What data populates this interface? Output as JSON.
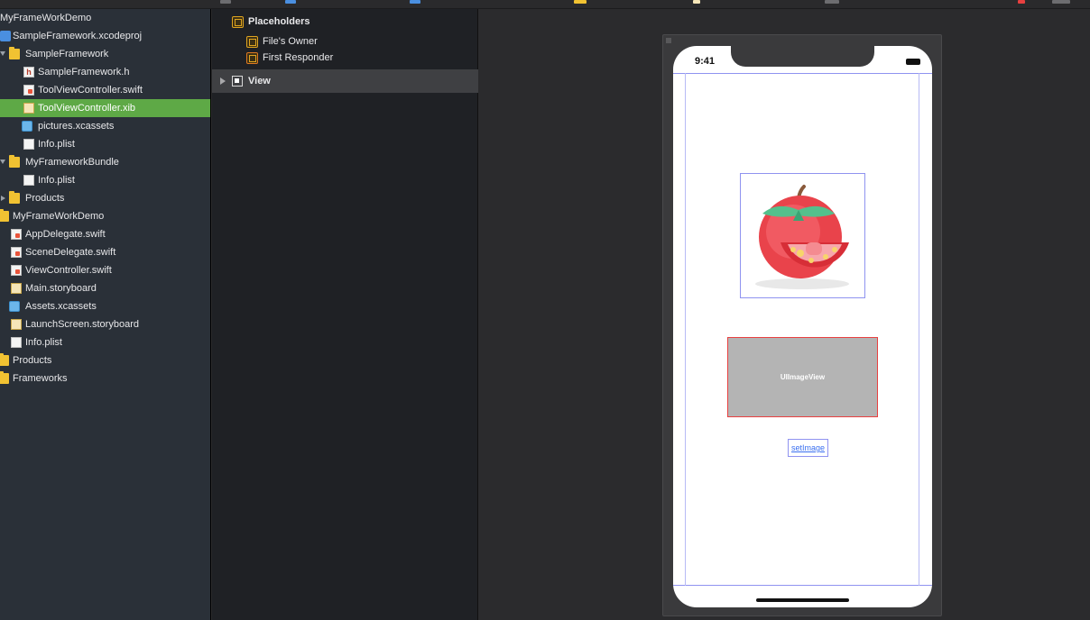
{
  "navigator": {
    "items": [
      {
        "label": "MyFrameWorkDemo",
        "icon": "project-icon",
        "level": 0
      },
      {
        "label": "SampleFramework.xcodeproj",
        "icon": "xcodeproj-icon",
        "level": 0
      },
      {
        "label": "SampleFramework",
        "icon": "folder-icon",
        "level": 1
      },
      {
        "label": "SampleFramework.h",
        "icon": "header-file-icon",
        "level": 2
      },
      {
        "label": "ToolViewController.swift",
        "icon": "swift-file-icon",
        "level": 2
      },
      {
        "label": "ToolViewController.xib",
        "icon": "xib-file-icon",
        "level": 2,
        "selected": true
      },
      {
        "label": "pictures.xcassets",
        "icon": "assets-icon",
        "level": 2
      },
      {
        "label": "Info.plist",
        "icon": "plist-file-icon",
        "level": 2
      },
      {
        "label": "MyFrameworkBundle",
        "icon": "folder-icon",
        "level": 1
      },
      {
        "label": "Info.plist",
        "icon": "plist-file-icon",
        "level": 2
      },
      {
        "label": "Products",
        "icon": "folder-icon",
        "level": 1
      },
      {
        "label": "MyFrameWorkDemo",
        "icon": "folder-icon",
        "level": 0
      },
      {
        "label": "AppDelegate.swift",
        "icon": "swift-file-icon",
        "level": 1
      },
      {
        "label": "SceneDelegate.swift",
        "icon": "swift-file-icon",
        "level": 1
      },
      {
        "label": "ViewController.swift",
        "icon": "swift-file-icon",
        "level": 1
      },
      {
        "label": "Main.storyboard",
        "icon": "storyboard-icon",
        "level": 1
      },
      {
        "label": "Assets.xcassets",
        "icon": "assets-icon",
        "level": 1
      },
      {
        "label": "LaunchScreen.storyboard",
        "icon": "storyboard-icon",
        "level": 1
      },
      {
        "label": "Info.plist",
        "icon": "plist-file-icon",
        "level": 1
      },
      {
        "label": "Products",
        "icon": "folder-icon",
        "level": 0
      },
      {
        "label": "Frameworks",
        "icon": "folder-icon",
        "level": 0
      }
    ],
    "selected_color": "#5ea946"
  },
  "outline": {
    "placeholders_label": "Placeholders",
    "files_owner_label": "File's Owner",
    "first_responder_label": "First Responder",
    "view_label": "View"
  },
  "canvas": {
    "status_time": "9:41",
    "image_view_label": "UIImageView",
    "button_label": "setImage"
  }
}
